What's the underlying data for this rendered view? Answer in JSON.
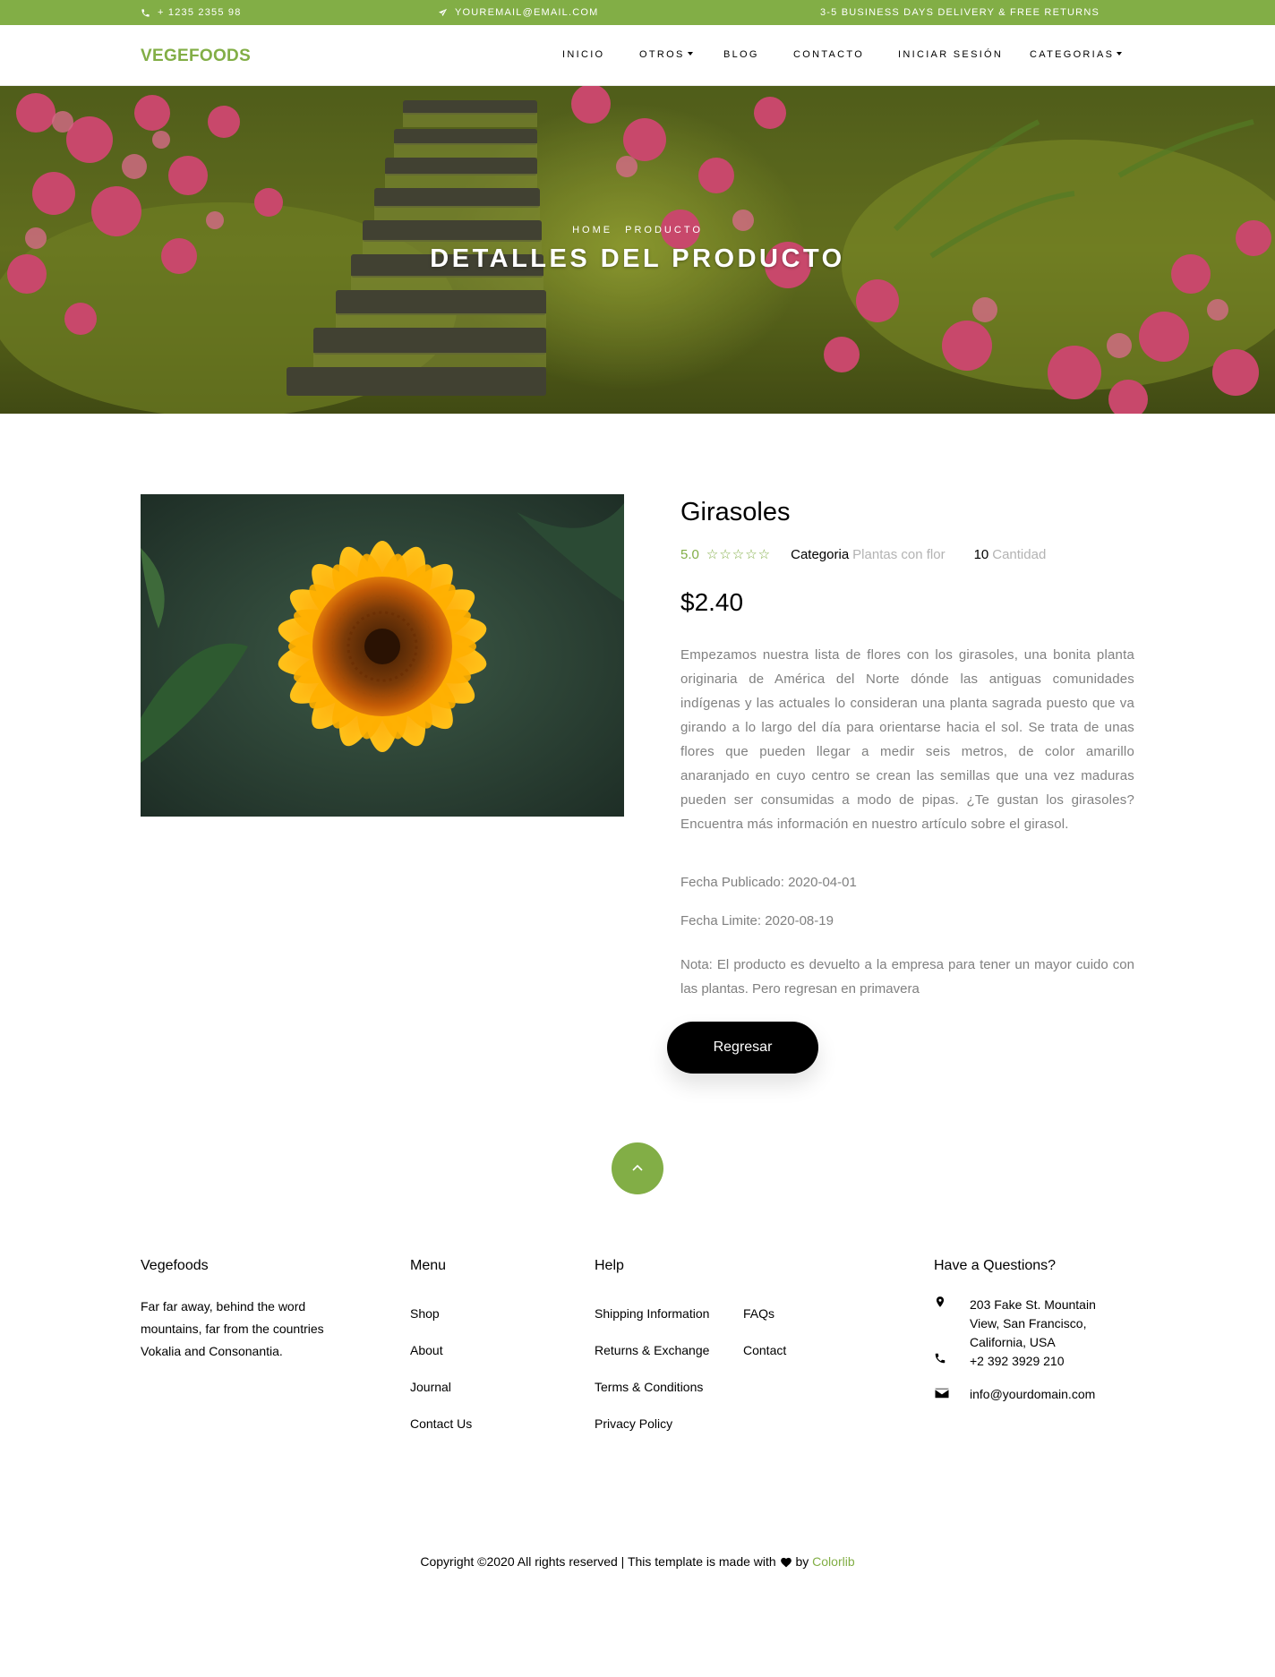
{
  "colors": {
    "accent": "#82ae46",
    "black": "#000000",
    "grey": "#808080"
  },
  "topbar": {
    "phone": "+ 1235 2355 98",
    "email": "YOUREMAIL@EMAIL.COM",
    "delivery": "3-5 BUSINESS DAYS DELIVERY & FREE RETURNS"
  },
  "nav": {
    "brand": "VEGEFOODS",
    "items": [
      "INICIO",
      "OTROS",
      "BLOG",
      "CONTACTO",
      "INICIAR SESIÓN",
      "CATEGORIAS"
    ]
  },
  "hero": {
    "breadcrumb_home": "HOME",
    "breadcrumb_current": "PRODUCTO",
    "title": "DETALLES DEL PRODUCTO"
  },
  "product": {
    "name": "Girasoles",
    "rating": "5.0",
    "stars_count": 5,
    "category_label": "Categoria",
    "category_value": "Plantas con flor",
    "quantity_number": "10",
    "quantity_label": "Cantidad",
    "price": "$2.40",
    "description": "Empezamos nuestra lista de flores con los girasoles, una bonita planta originaria de América del Norte dónde las antiguas comunidades indígenas y las actuales lo consideran una planta sagrada puesto que va girando a lo largo del día para orientarse hacia el sol. Se trata de unas flores que pueden llegar a medir seis metros, de color amarillo anaranjado en cuyo centro se crean las semillas que una vez maduras pueden ser consumidas a modo de pipas. ¿Te gustan los girasoles? Encuentra más información en nuestro artículo sobre el girasol.",
    "fecha_publicado": "Fecha Publicado: 2020-04-01",
    "fecha_limite": "Fecha Limite: 2020-08-19",
    "nota": "Nota: El producto es devuelto a la empresa para tener un mayor cuido con las plantas. Pero regresan en primavera",
    "back_button": "Regresar"
  },
  "footer": {
    "brand_heading": "Vegefoods",
    "brand_text": "Far far away, behind the word mountains, far from the countries Vokalia and Consonantia.",
    "menu_heading": "Menu",
    "menu_items": [
      "Shop",
      "About",
      "Journal",
      "Contact Us"
    ],
    "help_heading": "Help",
    "help_col1": [
      "Shipping Information",
      "Returns & Exchange",
      "Terms & Conditions",
      "Privacy Policy"
    ],
    "help_col2": [
      "FAQs",
      "Contact"
    ],
    "contact_heading": "Have a Questions?",
    "address": "203 Fake St. Mountain View, San Francisco, California, USA",
    "phone": "+2 392 3929 210",
    "email": "info@yourdomain.com",
    "copyright_prefix": "Copyright ©2020 All rights reserved | This template is made with",
    "copyright_by": "by",
    "copyright_link": "Colorlib"
  },
  "icons": [
    "phone-icon",
    "paper-plane-icon",
    "chevron-up-icon",
    "map-marker-icon",
    "phone-icon",
    "envelope-icon",
    "heart-icon",
    "star-icon"
  ]
}
